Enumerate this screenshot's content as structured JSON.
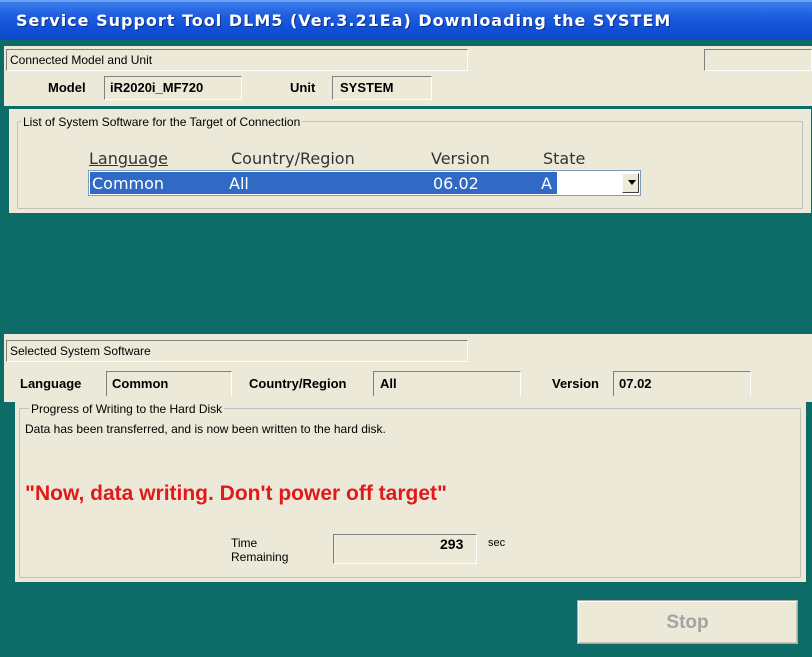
{
  "window": {
    "title": "Service Support Tool DLM5 (Ver.3.21Ea) Downloading the SYSTEM"
  },
  "connected": {
    "section_label": "Connected Model and Unit",
    "model_label": "Model",
    "model_value": "iR2020i_MF720",
    "unit_label": "Unit",
    "unit_value": "SYSTEM"
  },
  "software_list": {
    "group_label": "List of System Software for the Target of Connection",
    "headers": {
      "language": "Language",
      "country": "Country/Region",
      "version": "Version",
      "state": "State"
    },
    "selected_row": {
      "language": "Common",
      "country": "All",
      "version": "06.02",
      "state": "A"
    }
  },
  "selected": {
    "section_label": "Selected System Software",
    "language_label": "Language",
    "language_value": "Common",
    "country_label": "Country/Region",
    "country_value": "All",
    "version_label": "Version",
    "version_value": "07.02"
  },
  "progress": {
    "group_label": "Progress of Writing to the Hard Disk",
    "status_text": "Data has been transferred, and is now been written to the hard disk.",
    "warning_text": "\"Now, data writing. Don't power off target\"",
    "time_label_line1": "Time",
    "time_label_line2": "Remaining",
    "time_value": "293",
    "time_unit": "sec"
  },
  "buttons": {
    "stop": "Stop"
  },
  "colors": {
    "background": "#0d6b68",
    "panel": "#ece9d8",
    "selection": "#316ac5",
    "warning": "#e01a1a",
    "titlebar": "#1150d6"
  }
}
